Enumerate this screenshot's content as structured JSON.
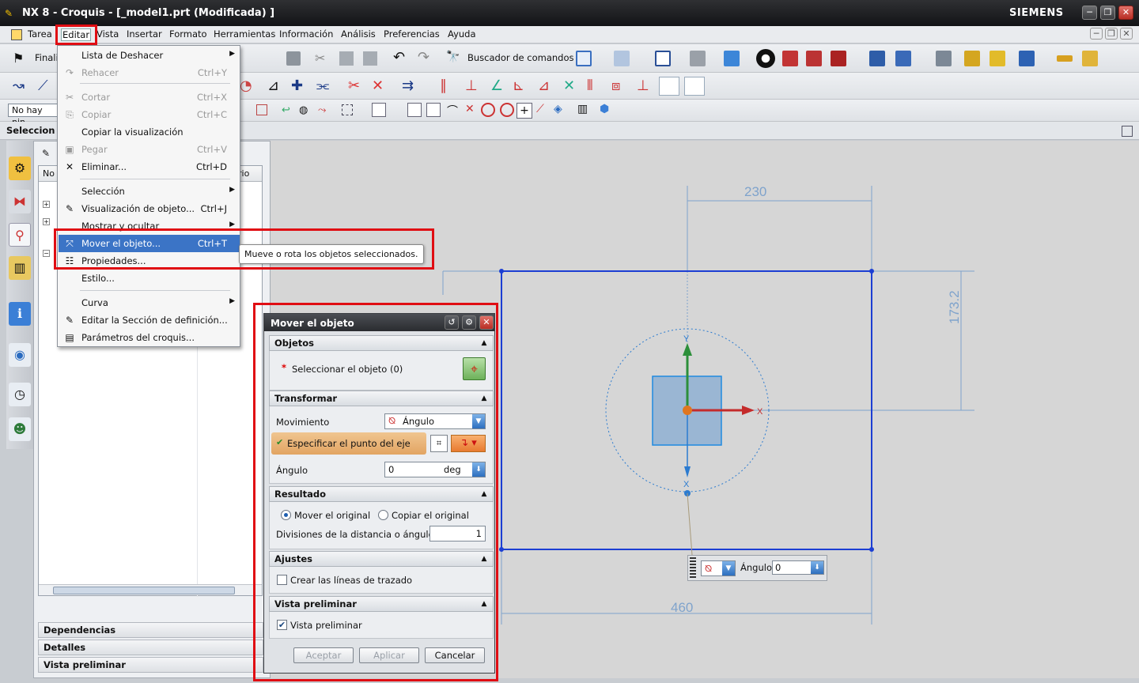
{
  "window": {
    "title": "NX 8 - Croquis - [_model1.prt (Modificada) ]",
    "brand": "SIEMENS",
    "controls": {
      "minimize": "─",
      "restore": "❐",
      "close": "✕"
    }
  },
  "menubar": [
    "Tarea",
    "Editar",
    "Vista",
    "Insertar",
    "Formato",
    "Herramientas",
    "Información",
    "Análisis",
    "Preferencias",
    "Ayuda"
  ],
  "toolbar": {
    "finish_label": "Finali",
    "command_finder": "Buscador de comandos",
    "filter_value": "No hay nin",
    "selection_bar_label": "Seleccion"
  },
  "edit_menu": {
    "items": [
      {
        "label": "Lista de Deshacer",
        "shortcut": "",
        "submenu": true,
        "disabled": false,
        "icon": ""
      },
      {
        "label": "Rehacer",
        "shortcut": "Ctrl+Y",
        "submenu": false,
        "disabled": true,
        "icon": "↷"
      },
      {
        "label": "Cortar",
        "shortcut": "Ctrl+X",
        "submenu": false,
        "disabled": true,
        "icon": "✂"
      },
      {
        "label": "Copiar",
        "shortcut": "Ctrl+C",
        "submenu": false,
        "disabled": true,
        "icon": "⎘"
      },
      {
        "label": "Copiar la visualización",
        "shortcut": "",
        "submenu": false,
        "disabled": false,
        "icon": ""
      },
      {
        "label": "Pegar",
        "shortcut": "Ctrl+V",
        "submenu": false,
        "disabled": true,
        "icon": "▣"
      },
      {
        "label": "Eliminar...",
        "shortcut": "Ctrl+D",
        "submenu": false,
        "disabled": false,
        "icon": "✕"
      },
      {
        "label": "Selección",
        "shortcut": "",
        "submenu": true,
        "disabled": false,
        "icon": ""
      },
      {
        "label": "Visualización de objeto...",
        "shortcut": "Ctrl+J",
        "submenu": false,
        "disabled": false,
        "icon": "✎"
      },
      {
        "label": "Mostrar y ocultar",
        "shortcut": "",
        "submenu": true,
        "disabled": false,
        "icon": ""
      },
      {
        "label": "Mover el objeto...",
        "shortcut": "Ctrl+T",
        "submenu": false,
        "disabled": false,
        "icon": "⤧",
        "highlighted": true
      },
      {
        "label": "Propiedades...",
        "shortcut": "",
        "submenu": false,
        "disabled": false,
        "icon": "☷"
      },
      {
        "label": "Estilo...",
        "shortcut": "",
        "submenu": false,
        "disabled": false,
        "icon": ""
      },
      {
        "label": "Curva",
        "shortcut": "",
        "submenu": true,
        "disabled": false,
        "icon": ""
      },
      {
        "label": "Editar la Sección de definición...",
        "shortcut": "",
        "submenu": false,
        "disabled": false,
        "icon": "✎"
      },
      {
        "label": "Parámetros del croquis...",
        "shortcut": "",
        "submenu": false,
        "disabled": false,
        "icon": "▤"
      }
    ]
  },
  "tooltip": "Mueve o rota los objetos seleccionados.",
  "nav_panel": {
    "col_left": "No",
    "col_right": "rio",
    "sections": [
      "Dependencias",
      "Detalles",
      "Vista preliminar"
    ]
  },
  "dialog": {
    "title": "Mover el objeto",
    "objects": {
      "header": "Objetos",
      "select_label": "Seleccionar el objeto (0)",
      "required_mark": "*"
    },
    "transform": {
      "header": "Transformar",
      "motion_label": "Movimiento",
      "motion_value": "Ángulo",
      "axis_point_label": "Especificar el punto del eje",
      "angle_label": "Ángulo",
      "angle_value": "0",
      "angle_unit": "deg"
    },
    "result": {
      "header": "Resultado",
      "move_original": "Mover el original",
      "copy_original": "Copiar el original",
      "divisions_label": "Divisiones de la distancia o ángulo",
      "divisions_value": "1"
    },
    "settings": {
      "header": "Ajustes",
      "trace_lines": "Crear las líneas de trazado"
    },
    "preview": {
      "header": "Vista preliminar",
      "preview_label": "Vista preliminar"
    },
    "buttons": {
      "ok": "Aceptar",
      "apply": "Aplicar",
      "cancel": "Cancelar"
    }
  },
  "graphics": {
    "dim_top": "230",
    "dim_right": "173.2",
    "dim_bottom": "460",
    "axis_y": "Y",
    "axis_x": "X",
    "popup_label": "Ángulo",
    "popup_value": "0"
  }
}
